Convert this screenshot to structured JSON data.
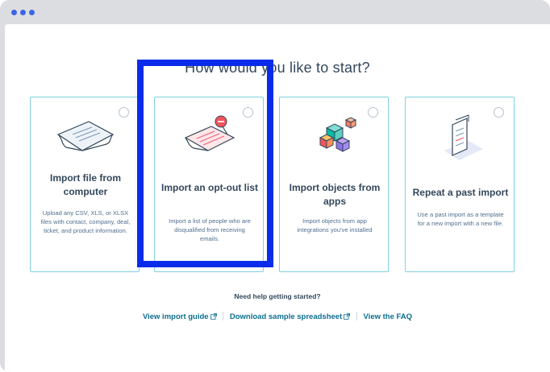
{
  "heading": "How would you like to start?",
  "cards": [
    {
      "icon": "paper-document-icon",
      "title": "Import file from computer",
      "description": "Upload any CSV, XLS, or XLSX files with contact, company, deal, ticket, and product information."
    },
    {
      "icon": "opt-out-document-icon",
      "title": "Import an opt-out list",
      "description": "Import a list of people who are disqualified from receiving emails."
    },
    {
      "icon": "app-blocks-icon",
      "title": "Import objects from apps",
      "description": "Import objects from app integrations you've installed"
    },
    {
      "icon": "past-import-document-icon",
      "title": "Repeat a past import",
      "description": "Use a past import as a template for a new import with a new file."
    }
  ],
  "help": {
    "title": "Need help getting started?",
    "links": [
      {
        "label": "View import guide",
        "external": true
      },
      {
        "label": "Download sample spreadsheet",
        "external": true
      },
      {
        "label": "View the FAQ",
        "external": false
      }
    ]
  },
  "colors": {
    "window_dots": "#3d65e6",
    "card_border": "#7fd1de",
    "highlight": "#0a2bea",
    "link": "#0b6e8f"
  }
}
